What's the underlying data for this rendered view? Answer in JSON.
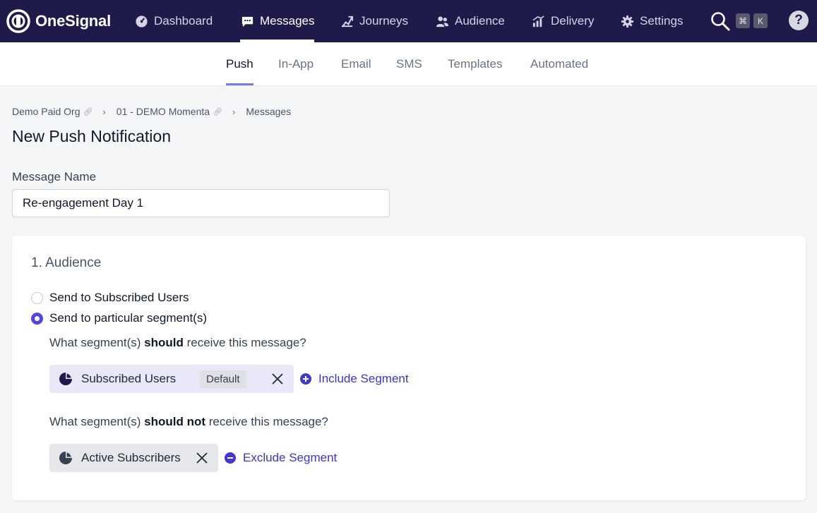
{
  "app": {
    "name": "OneSignal"
  },
  "nav": {
    "items": [
      {
        "label": "Dashboard",
        "icon": "dashboard-icon"
      },
      {
        "label": "Messages",
        "icon": "message-icon",
        "active": true
      },
      {
        "label": "Journeys",
        "icon": "journey-icon"
      },
      {
        "label": "Audience",
        "icon": "audience-icon"
      },
      {
        "label": "Delivery",
        "icon": "delivery-icon"
      },
      {
        "label": "Settings",
        "icon": "gear-icon"
      }
    ],
    "shortcut_keys": [
      "⌘",
      "K"
    ],
    "help_label": "?"
  },
  "subnav": {
    "tabs": [
      {
        "label": "Push",
        "active": true
      },
      {
        "label": "In-App"
      },
      {
        "label": "Email"
      },
      {
        "label": "SMS"
      },
      {
        "label": "Templates"
      },
      {
        "label": "Automated"
      }
    ]
  },
  "breadcrumb": [
    "Demo Paid Org",
    "01 - DEMO Momenta",
    "Messages"
  ],
  "page": {
    "title": "New Push Notification",
    "message_name_label": "Message Name",
    "message_name_value": "Re-engagement Day 1"
  },
  "audience": {
    "title": "1. Audience",
    "option_subscribed": "Send to Subscribed Users",
    "option_segments": "Send to particular segment(s)",
    "selected": "segments",
    "include_question_pre": "What segment(s) ",
    "include_question_bold": "should",
    "include_question_post": " receive this message?",
    "exclude_question_pre": "What segment(s) ",
    "exclude_question_bold": "should not",
    "exclude_question_post": " receive this message?",
    "included_segment": "Subscribed Users",
    "included_badge": "Default",
    "include_action": "Include Segment",
    "excluded_segment": "Active Subscribers",
    "exclude_action": "Exclude Segment"
  },
  "colors": {
    "nav_bg": "#1e1b4b",
    "accent": "#4f46e5",
    "link": "#3b36c4"
  }
}
